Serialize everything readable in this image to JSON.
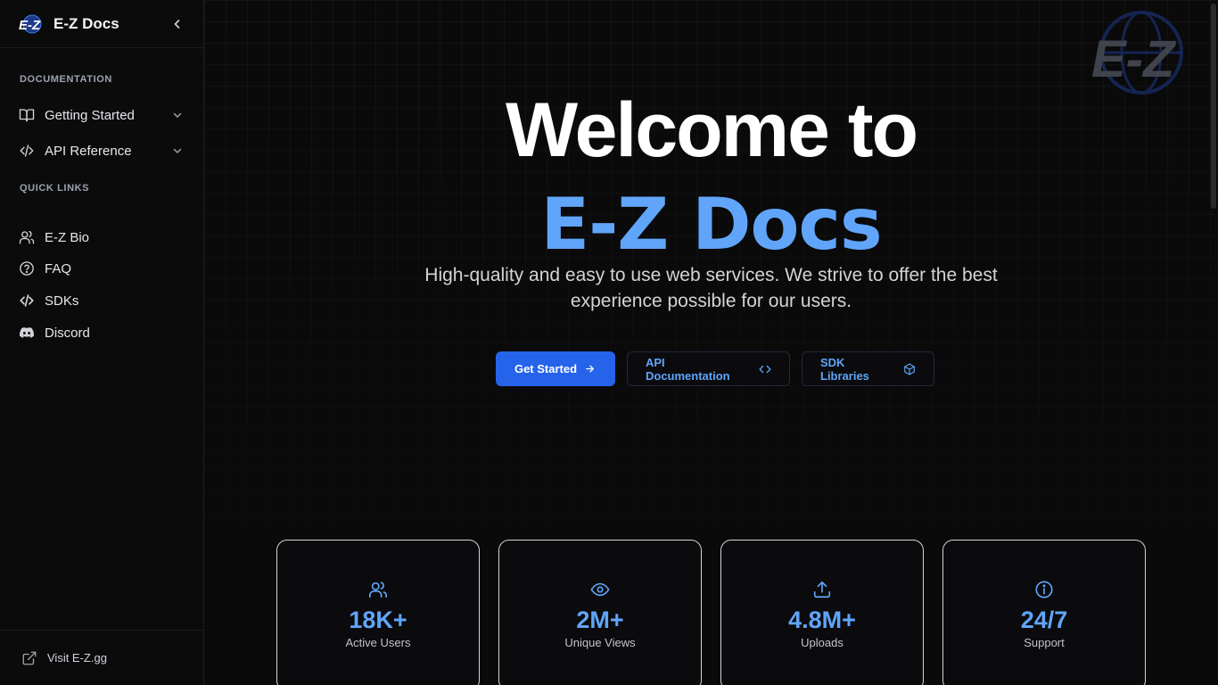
{
  "sidebar": {
    "brand": "E-Z Docs",
    "logo_text": "E-Z",
    "sections": {
      "documentation": "DOCUMENTATION",
      "quick_links": "QUICK LINKS"
    },
    "doc_items": [
      {
        "label": "Getting Started",
        "icon": "book-icon"
      },
      {
        "label": "API Reference",
        "icon": "code-icon"
      }
    ],
    "quick_items": [
      {
        "label": "E-Z Bio",
        "icon": "users-icon"
      },
      {
        "label": "FAQ",
        "icon": "help-circle-icon"
      },
      {
        "label": "SDKs",
        "icon": "code-icon"
      },
      {
        "label": "Discord",
        "icon": "discord-icon"
      }
    ],
    "footer_link": "Visit E-Z.gg"
  },
  "hero": {
    "title": "Welcome to",
    "subtitle": "E-Z Docs",
    "description": "High-quality and easy to use web services. We strive to offer the best experience possible for our users."
  },
  "actions": {
    "primary": "Get Started",
    "api_docs": "API Documentation",
    "sdk": "SDK Libraries"
  },
  "stats": [
    {
      "value": "18K+",
      "label": "Active Users",
      "icon": "users-icon"
    },
    {
      "value": "2M+",
      "label": "Unique Views",
      "icon": "eye-icon"
    },
    {
      "value": "4.8M+",
      "label": "Uploads",
      "icon": "upload-icon"
    },
    {
      "value": "24/7",
      "label": "Support",
      "icon": "info-icon"
    }
  ],
  "colors": {
    "accent": "#60a5fa",
    "primary_button": "#2563eb",
    "background": "#0a0a0b"
  }
}
